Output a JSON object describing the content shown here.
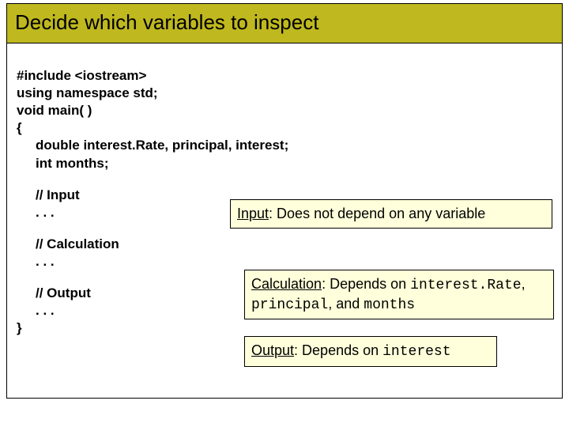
{
  "title": "Decide which variables to inspect",
  "code": {
    "l1": "#include <iostream>",
    "l2": "using namespace std;",
    "l3": "void main( )",
    "l4": "{",
    "l5": "double interest.Rate, principal, interest;",
    "l6": "int months;",
    "l7": "// Input",
    "l8": ". . .",
    "l9": "// Calculation",
    "l10": ". . .",
    "l11": "// Output",
    "l12": ". . .",
    "l13": "}"
  },
  "callouts": {
    "input": {
      "label": "Input",
      "text": ": Does not depend on any variable"
    },
    "calc": {
      "label": "Calculation",
      "pre": ": Depends on ",
      "v1": "interest.Rate",
      "sep1": ", ",
      "v2": "principal",
      "sep2": ", and ",
      "v3": "months"
    },
    "output": {
      "label": "Output",
      "pre": ": Depends on ",
      "v1": "interest"
    }
  }
}
